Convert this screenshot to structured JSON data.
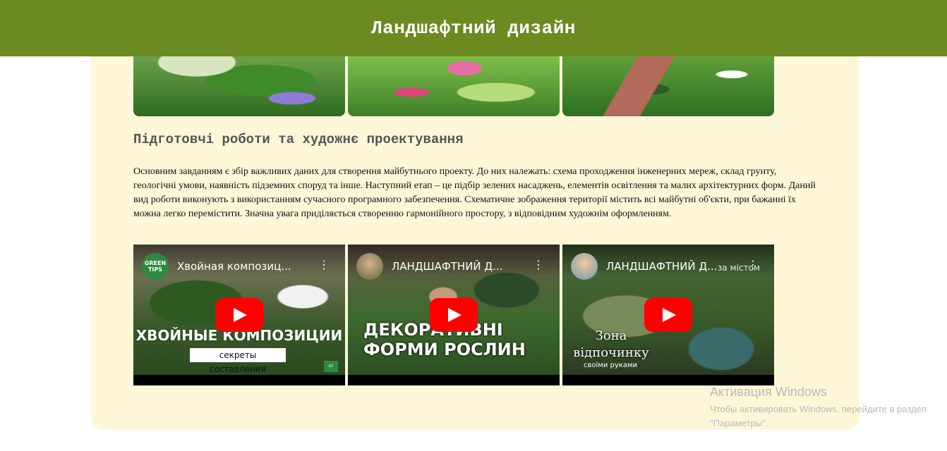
{
  "header": {
    "title": "Ландшафтний дизайн",
    "bg": "#6b8a1f"
  },
  "colors": {
    "content_bg": "#fdf7d8"
  },
  "section": {
    "title": "Підготовчі роботи та художнє проектування",
    "paragraph": "Основним завданням є збір важливих даних для створення майбутнього проекту. До них належать: схема проходження інженерних мереж, склад грунту, геологічні умови, наявність підземних споруд та інше. Наступний етап – це підбір зелених насаджень, елементів освітлення та малих архітектурних форм. Даний вид роботи виконують з використанням сучасного програмного забезпечення. Схематичне зображення території містить всі майбутні об'єкти, при бажанні їх можна легко перемістити. Значна увага приділяється створенню гармонійного простору, з відповідним художнім оформленням."
  },
  "videos": [
    {
      "title": "Хвойная композиц...",
      "channel_text": "GREEN TIPS",
      "caption": "ХВОЙНЫЕ КОМПОЗИЦИИ",
      "subcaption": "секреты составления"
    },
    {
      "title": "ЛАНДШАФТНИЙ Д...",
      "channel_text": "",
      "caption": "ДЕКОРАТИВНІ ФОРМИ РОСЛИН"
    },
    {
      "title": "ЛАНДШАФТНИЙ Д...",
      "channel_text": "",
      "extra": "за містом",
      "caption": "Зона відпочинку",
      "subcaption": "своїми руками"
    }
  ],
  "icons": {
    "play": "youtube-play-icon",
    "more": "more-vert-icon"
  },
  "watermark": {
    "title": "Активация Windows",
    "text": "Чтобы активировать Windows, перейдите в раздел \"Параметры\"."
  }
}
